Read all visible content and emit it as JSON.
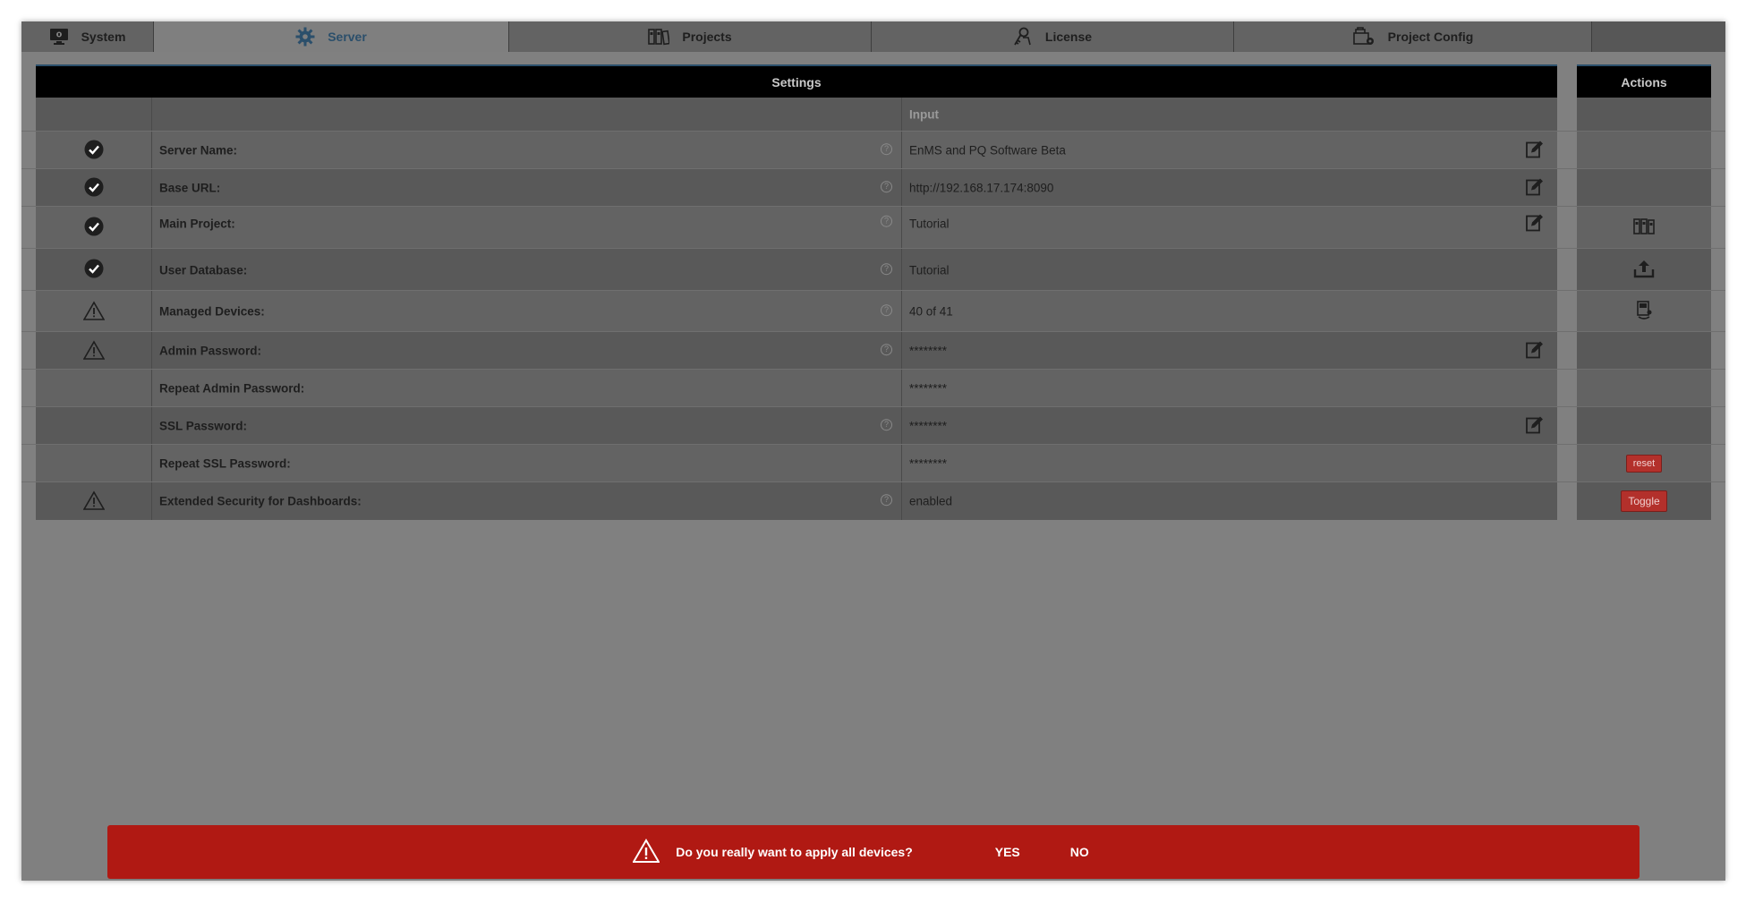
{
  "tabs": [
    {
      "label": "System",
      "icon": "monitor-icon",
      "active": false
    },
    {
      "label": "Server",
      "icon": "gear-icon",
      "active": true
    },
    {
      "label": "Projects",
      "icon": "binders-icon",
      "active": false
    },
    {
      "label": "License",
      "icon": "key-person-icon",
      "active": false
    },
    {
      "label": "Project Config",
      "icon": "config-icon",
      "active": false
    }
  ],
  "table": {
    "settings_header": "Settings",
    "actions_header": "Actions",
    "input_header": "Input",
    "rows": [
      {
        "status": "check",
        "label": "Server Name:",
        "value": "EnMS and PQ Software Beta",
        "editable": true,
        "action": ""
      },
      {
        "status": "check",
        "label": "Base URL:",
        "value": "http://192.168.17.174:8090",
        "editable": true,
        "action": ""
      },
      {
        "status": "check",
        "label": "Main Project:",
        "value": "Tutorial",
        "editable": true,
        "action": "projects-icon"
      },
      {
        "status": "check",
        "label": "User Database:",
        "value": "Tutorial",
        "editable": false,
        "action": "upload-icon"
      },
      {
        "status": "warning",
        "label": "Managed Devices:",
        "value": "40 of 41",
        "editable": false,
        "action": "devices-icon"
      },
      {
        "status": "warning",
        "label": "Admin Password:",
        "value": "********",
        "editable": true,
        "action": ""
      },
      {
        "status": "",
        "label": "Repeat Admin Password:",
        "value": "********",
        "editable": false,
        "action": ""
      },
      {
        "status": "",
        "label": "SSL Password:",
        "value": "********",
        "editable": true,
        "action": ""
      },
      {
        "status": "",
        "label": "Repeat SSL Password:",
        "value": "********",
        "editable": false,
        "action": "reset"
      },
      {
        "status": "warning",
        "label": "Extended Security for Dashboards:",
        "value": "enabled",
        "editable": false,
        "action": "Toggle"
      }
    ]
  },
  "confirm": {
    "message": "Do you really want to apply all devices?",
    "yes": "YES",
    "no": "NO"
  },
  "colors": {
    "accent": "#2b4f6b",
    "dialog": "#b01913",
    "button_red": "#b3302b"
  }
}
